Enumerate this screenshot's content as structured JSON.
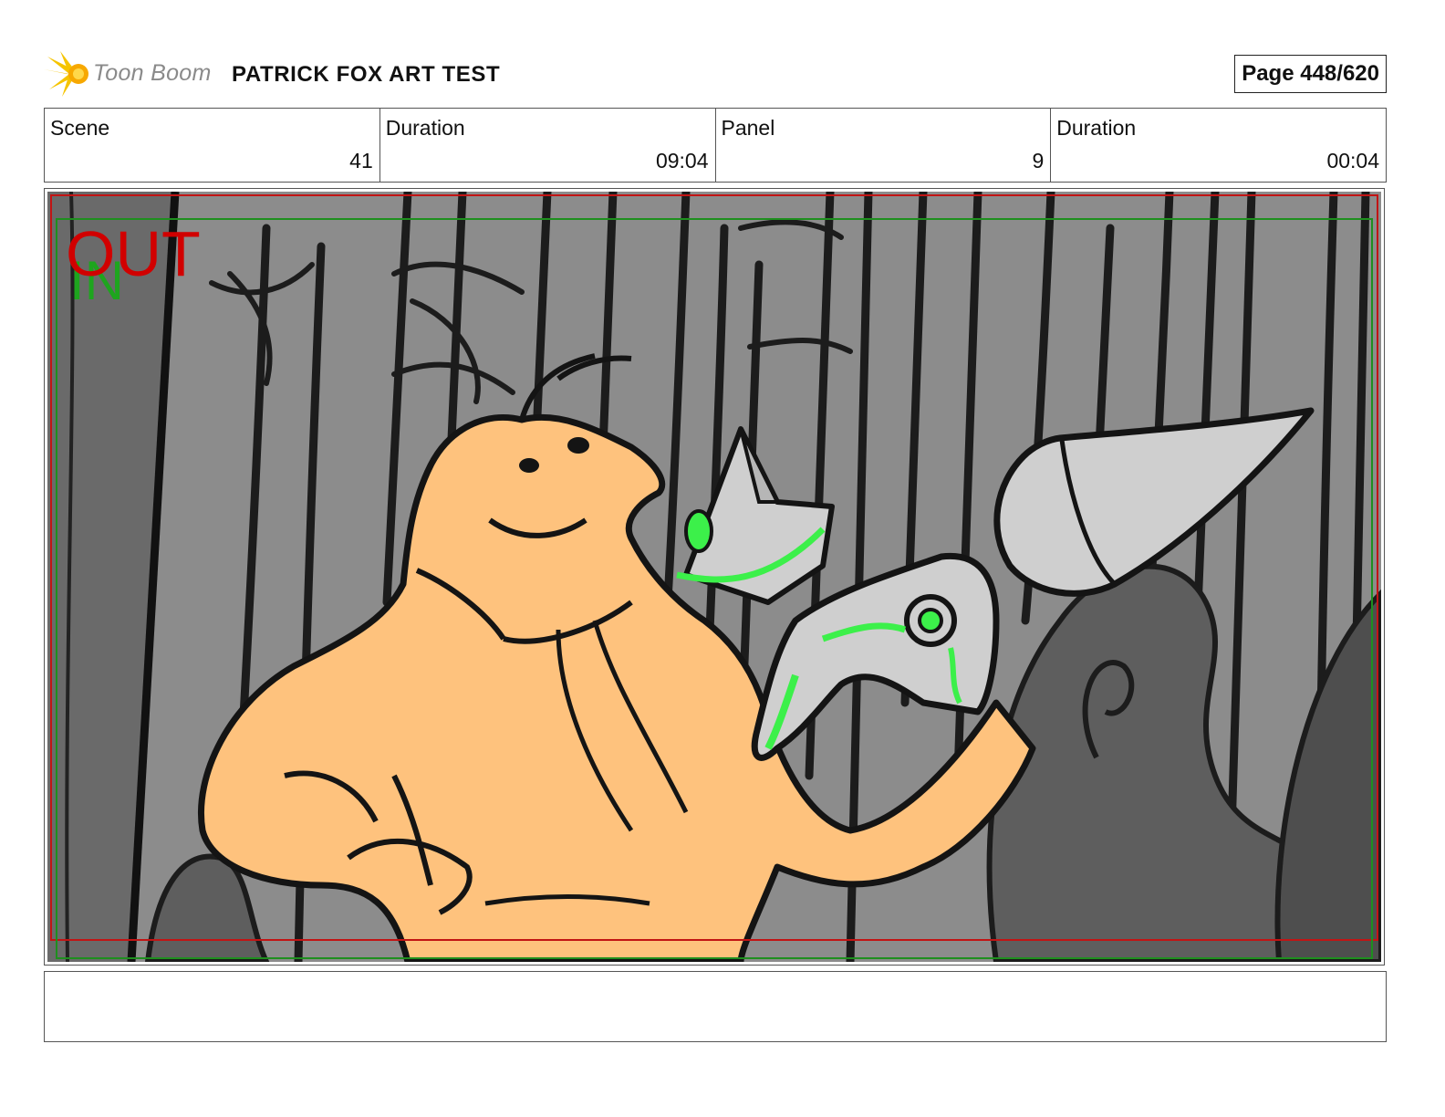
{
  "header": {
    "logo_text": "Toon Boom",
    "project_title": "PATRICK FOX ART TEST",
    "page_label": "Page 448/620"
  },
  "info": {
    "scene_label": "Scene",
    "scene_value": "41",
    "scene_duration_label": "Duration",
    "scene_duration_value": "09:04",
    "panel_label": "Panel",
    "panel_value": "9",
    "panel_duration_label": "Duration",
    "panel_duration_value": "00:04"
  },
  "panel": {
    "overlay_out": "OUT",
    "overlay_in": "IN",
    "colors": {
      "background": "#8c8c8c",
      "character": "#fec27d",
      "robot": "#cfcfcf",
      "glow": "#3cf04a",
      "out_marker": "#d10000",
      "in_marker": "#1ea51e"
    }
  },
  "caption": {
    "text": ""
  }
}
